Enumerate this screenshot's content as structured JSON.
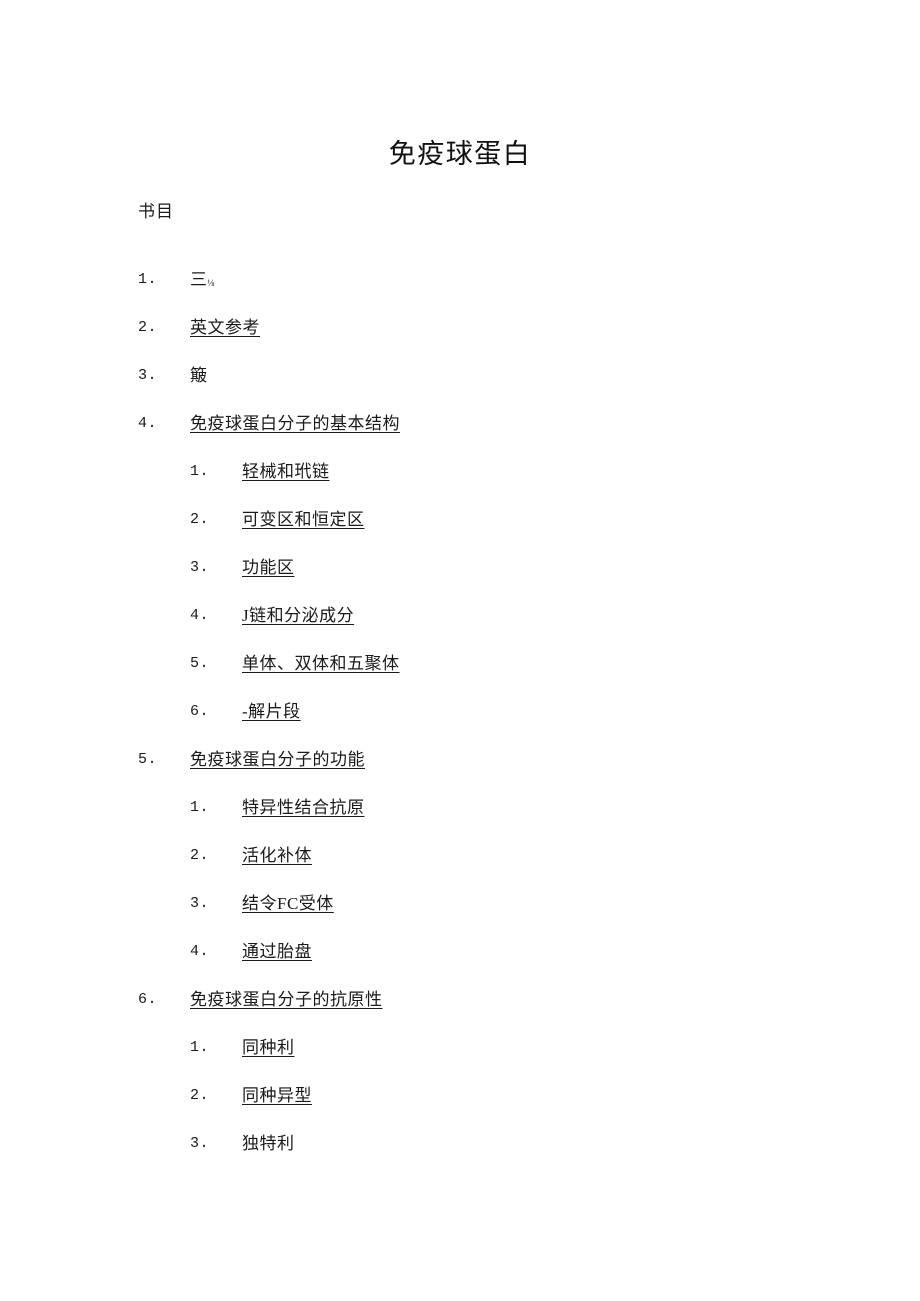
{
  "document": {
    "title": "免疫球蛋白",
    "toc_heading": "书目"
  },
  "outline": [
    {
      "number": "1.",
      "label": "三",
      "trailing_mark": "⅛",
      "underlined": false,
      "level": 1
    },
    {
      "number": "2.",
      "label": "英文参考",
      "underlined": true,
      "level": 1
    },
    {
      "number": "3.",
      "label": "簸",
      "underlined": false,
      "level": 1
    },
    {
      "number": "4.",
      "label": "免疫球蛋白分子的基本结构",
      "underlined": true,
      "level": 1
    },
    {
      "number": "1.",
      "label": "轻械和玳链",
      "underlined": true,
      "level": 2
    },
    {
      "number": "2.",
      "label": "可变区和恒定区",
      "underlined": true,
      "level": 2
    },
    {
      "number": "3.",
      "label": "功能区",
      "underlined": true,
      "level": 2
    },
    {
      "number": "4.",
      "label": "J链和分泌成分",
      "underlined": true,
      "level": 2
    },
    {
      "number": "5.",
      "label": "单体、双体和五聚体",
      "underlined": true,
      "level": 2
    },
    {
      "number": "6.",
      "label": "-解片段",
      "underlined": true,
      "level": 2
    },
    {
      "number": "5.",
      "label": "免疫球蛋白分子的功能",
      "underlined": true,
      "level": 1
    },
    {
      "number": "1.",
      "label": "特异性结合抗原",
      "underlined": true,
      "level": 2
    },
    {
      "number": "2.",
      "label": "活化补体",
      "underlined": true,
      "level": 2
    },
    {
      "number": "3.",
      "label": "结令FC受体",
      "underlined": true,
      "level": 2
    },
    {
      "number": "4.",
      "label": "通过胎盘",
      "underlined": true,
      "level": 2
    },
    {
      "number": "6.",
      "label": "免疫球蛋白分子的抗原性",
      "underlined": true,
      "level": 1
    },
    {
      "number": "1.",
      "label": "同种利",
      "underlined": true,
      "level": 2
    },
    {
      "number": "2.",
      "label": "同种异型",
      "underlined": true,
      "level": 2
    },
    {
      "number": "3.",
      "label": "独特利",
      "underlined": false,
      "level": 2
    }
  ],
  "colors": {
    "page_background": "#ffffff",
    "text": "#1a1a1a"
  }
}
